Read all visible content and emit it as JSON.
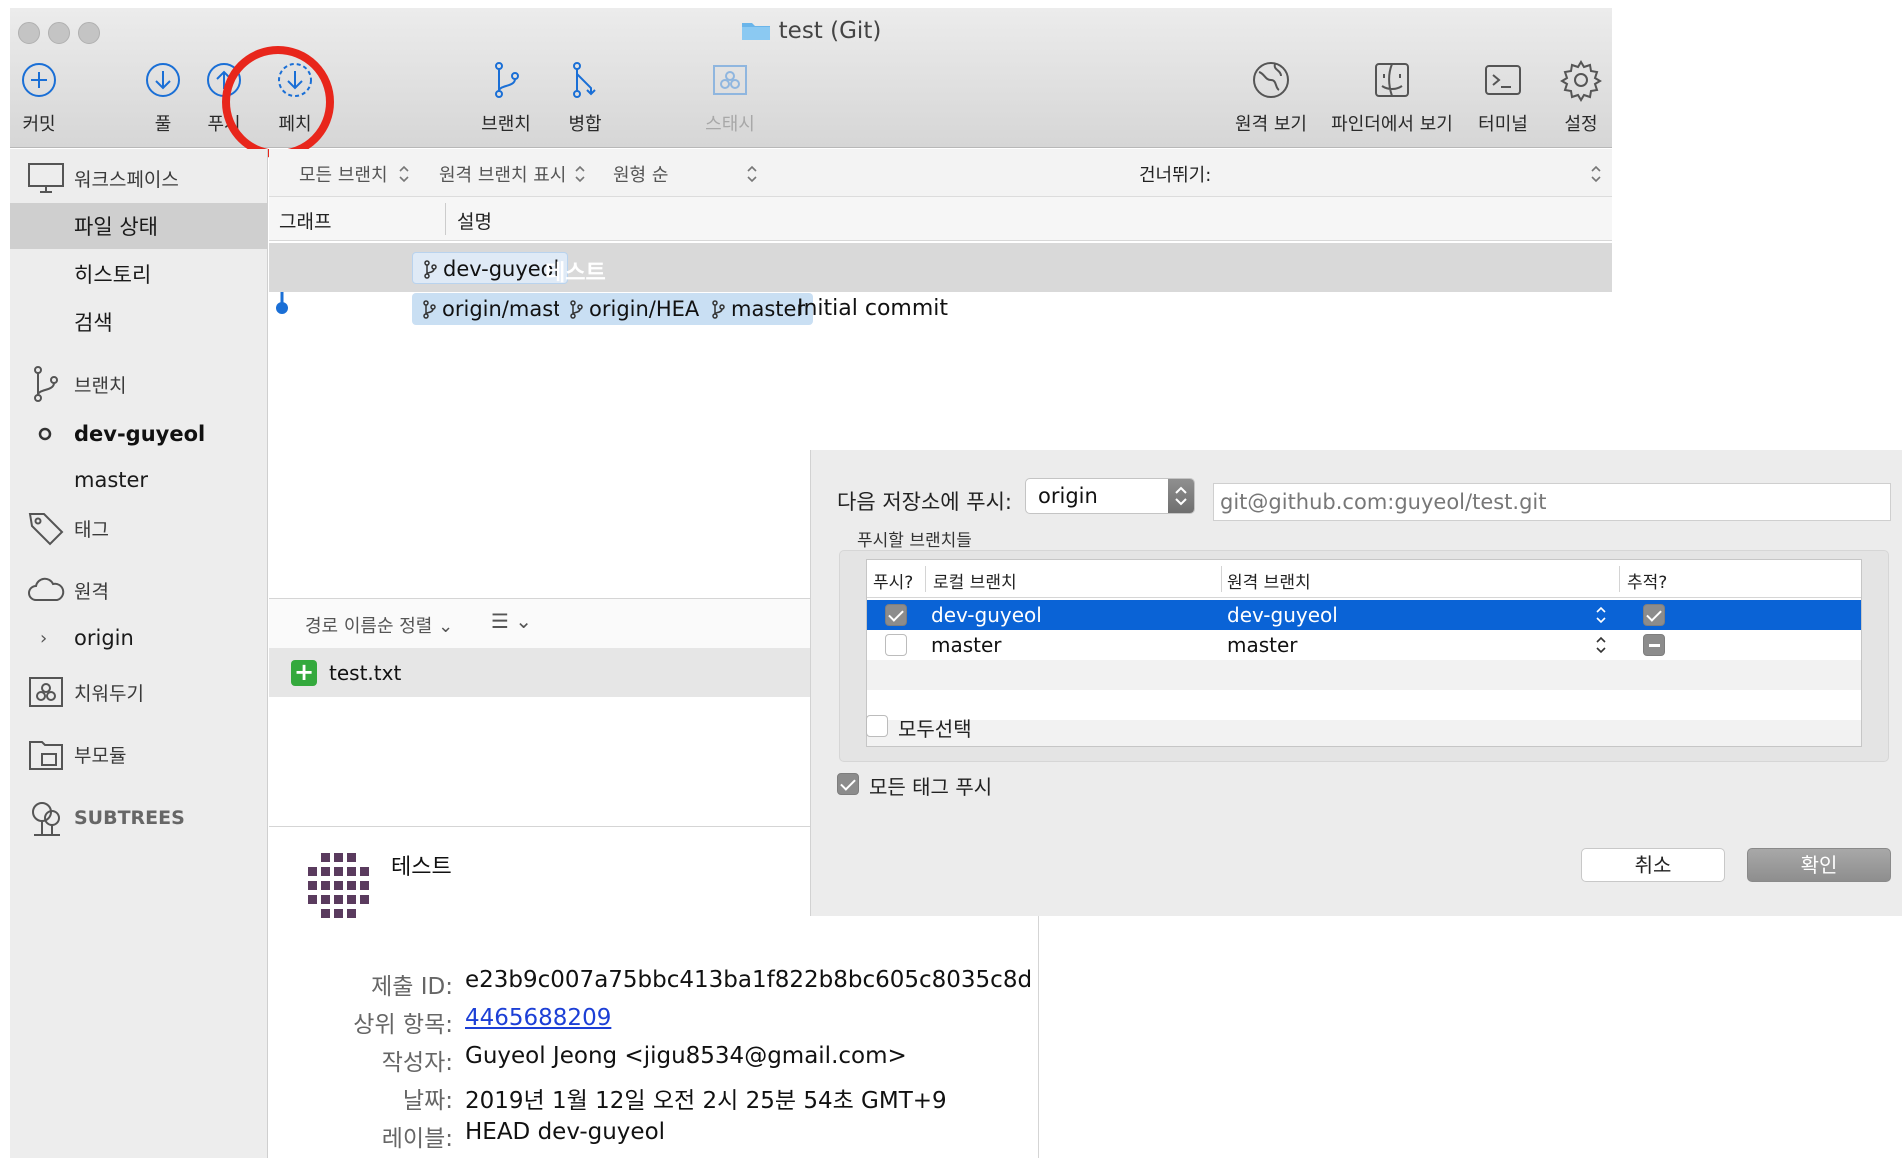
{
  "window": {
    "title": "test (Git)"
  },
  "toolbar": {
    "commit": "커밋",
    "pull": "풀",
    "push": "푸시",
    "fetch": "페치",
    "branch": "브랜치",
    "merge": "병합",
    "stash": "스태시",
    "remote_view": "원격 보기",
    "finder_view": "파인더에서 보기",
    "terminal": "터미널",
    "settings": "설정"
  },
  "sidebar": {
    "workspace": "워크스페이스",
    "file_status": "파일 상태",
    "history": "히스토리",
    "search": "검색",
    "branches": "브랜치",
    "branch_items": [
      "dev-guyeol",
      "master"
    ],
    "tags": "태그",
    "remotes": "원격",
    "remote_items": [
      "origin"
    ],
    "stashes": "치워두기",
    "submodules": "부모듈",
    "subtrees": "SUBTREES"
  },
  "filter": {
    "all_branches": "모든 브랜치",
    "show_remote": "원격 브랜치 표시",
    "ancestor_order": "원형 순",
    "jump_to": "건너뛰기:"
  },
  "columns": {
    "graph": "그래프",
    "description": "설명"
  },
  "commits": [
    {
      "refs": [
        "dev-guyeol"
      ],
      "message": "테스트"
    },
    {
      "refs": [
        "origin/master",
        "origin/HEAD",
        "master"
      ],
      "message": "Initial commit"
    }
  ],
  "files": {
    "sort_label": "경로 이름순 정렬",
    "items": [
      "test.txt"
    ]
  },
  "detail": {
    "title": "테스트",
    "labels": {
      "id": "제출 ID:",
      "parent": "상위 항목:",
      "author": "작성자:",
      "date": "날짜:",
      "label": "레이블:"
    },
    "id": "e23b9c007a75bbc413ba1f822b8bc605c8035c8d",
    "parent": "4465688209",
    "author": "Guyeol Jeong <jigu8534@gmail.com>",
    "date": "2019년 1월 12일 오전 2시 25분 54초 GMT+9",
    "label": "HEAD dev-guyeol"
  },
  "push_dialog": {
    "repo_label": "다음 저장소에 푸시:",
    "repo_value": "origin",
    "url": "git@github.com:guyeol/test.git",
    "branches_label": "푸시할 브랜치들",
    "headers": {
      "push": "푸시?",
      "local": "로컬 브랜치",
      "remote": "원격 브랜치",
      "track": "추적?"
    },
    "rows": [
      {
        "local": "dev-guyeol",
        "remote": "dev-guyeol",
        "push": true,
        "track": true
      },
      {
        "local": "master",
        "remote": "master",
        "push": false,
        "track": false
      }
    ],
    "select_all": "모두선택",
    "push_all_tags": "모든 태그 푸시",
    "cancel": "취소",
    "ok": "확인"
  },
  "colors": {
    "accent": "#0a63d6",
    "annotation_circle": "#e8261b",
    "tag_bg": "#c9dff3",
    "added": "#34a93d",
    "link": "#1c3fd6"
  }
}
